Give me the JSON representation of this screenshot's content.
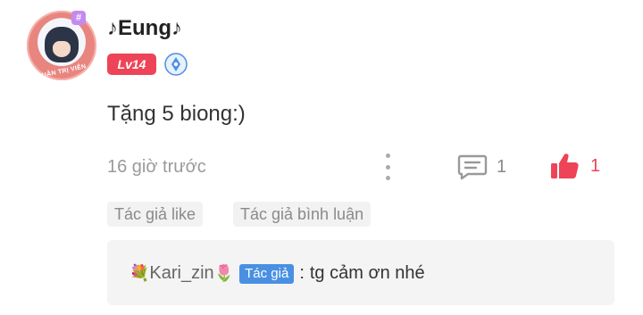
{
  "user": {
    "avatar_text": "QUÂN TRỊ VIÊN",
    "avatar_badge": "#",
    "name": "♪Eung♪",
    "level": "Lv14"
  },
  "post": {
    "content": "Tặng 5 biong:)",
    "time": "16 giờ trước",
    "comment_count": "1",
    "like_count": "1"
  },
  "tags": [
    "Tác giả like",
    "Tác giả bình luận"
  ],
  "reply": {
    "emoji_left": "💐",
    "username": "Kari_zin",
    "emoji_right": "🌷",
    "author_badge": "Tác giả",
    "separator": ":",
    "text": "tg cảm ơn nhé"
  },
  "colors": {
    "accent_red": "#ee4457",
    "author_blue": "#4a90e2",
    "muted_text": "#9a9a9a",
    "reply_bg": "#f4f4f4"
  },
  "icons": [
    "verified-badge-icon",
    "more-vertical-icon",
    "comment-icon",
    "thumbs-up-icon"
  ]
}
